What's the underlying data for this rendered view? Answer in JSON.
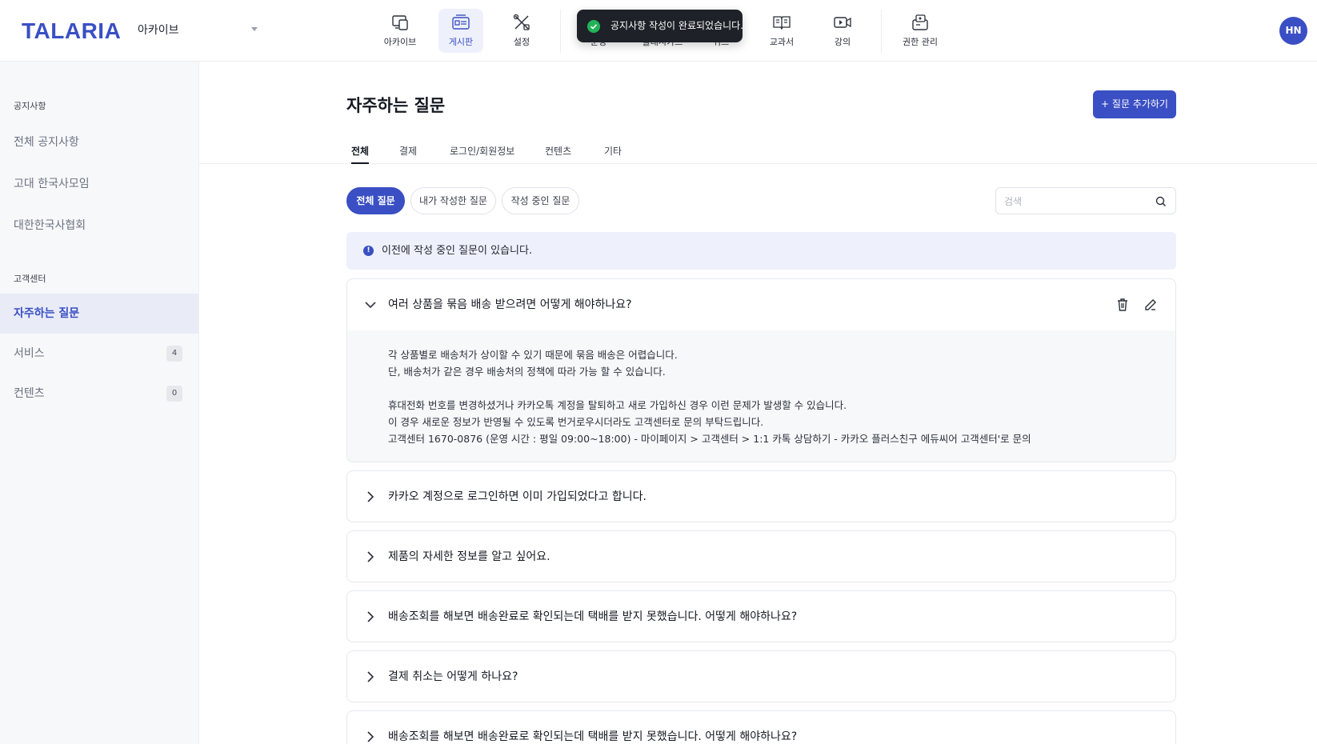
{
  "header": {
    "logo": "TALARIA",
    "archive_select": "아카이브",
    "nav": [
      {
        "label": "아카이브",
        "icon": "archive-icon"
      },
      {
        "label": "게시판",
        "icon": "board-icon"
      },
      {
        "label": "설정",
        "icon": "settings-icon"
      },
      {
        "label": "운영",
        "icon": "operation-icon"
      },
      {
        "label": "플래시카드",
        "icon": "flashcard-icon"
      },
      {
        "label": "퀴즈",
        "icon": "quiz-icon"
      },
      {
        "label": "교과서",
        "icon": "textbook-icon"
      },
      {
        "label": "강의",
        "icon": "lecture-icon"
      },
      {
        "label": "권한 관리",
        "icon": "permission-icon"
      }
    ],
    "avatar": "HN"
  },
  "toast": {
    "message": "공지사항 작성이 완료되었습니다."
  },
  "sidebar": {
    "groups": [
      {
        "title": "공지사항",
        "items": [
          {
            "label": "전체 공지사항"
          },
          {
            "label": "고대 한국사모임"
          },
          {
            "label": "대한한국사협회"
          }
        ]
      },
      {
        "title": "고객센터",
        "items": [
          {
            "label": "자주하는 질문"
          },
          {
            "label": "서비스",
            "count": "4"
          },
          {
            "label": "컨텐츠",
            "count": "0"
          }
        ]
      }
    ]
  },
  "main": {
    "title": "자주하는 질문",
    "add_button": "+ 질문 추가하기",
    "tabs": [
      "전체",
      "결제",
      "로그인/회원정보",
      "컨텐츠",
      "기타"
    ],
    "filters": [
      "전체 질문",
      "내가 작성한 질문",
      "작성 중인 질문"
    ],
    "search_placeholder": "검색",
    "notice": "이전에 작성 중인 질문이 있습니다.",
    "faqs": [
      {
        "question": "여러 상품을 묶음 배송 받으려면 어떻게 해야하나요?",
        "answer": [
          "각 상품별로 배송처가 상이할 수 있기 때문에 묶음 배송은 어렵습니다.",
          "단, 배송처가 같은 경우 배송처의 정책에 따라 가능 할 수 있습니다.",
          "",
          "휴대전화 번호를 변경하셨거나 카카오톡 계정을 탈퇴하고 새로 가입하신 경우 이런 문제가 발생할 수 있습니다.",
          "이 경우 새로운 정보가 반영될 수 있도록 번거로우시더라도 고객센터로 문의 부탁드립니다.",
          "고객센터 1670-0876 (운영 시간 : 평일 09:00~18:00) - 마이페이지  > 고객센터 > 1:1 카톡 상담하기 - 카카오 플러스친구 에듀씨어 고객센터'로 문의"
        ]
      },
      {
        "question": "카카오 계정으로 로그인하면 이미 가입되었다고 합니다."
      },
      {
        "question": "제품의 자세한 정보를 알고 싶어요."
      },
      {
        "question": "배송조회를 해보면 배송완료로 확인되는데 택배를 받지 못했습니다. 어떻게 해야하나요?"
      },
      {
        "question": "결제 취소는 어떻게 하나요?"
      },
      {
        "question": "배송조회를 해보면 배송완료로 확인되는데 택배를 받지 못했습니다. 어떻게 해야하나요?"
      }
    ]
  },
  "colors": {
    "accent": "#3a4fc4",
    "success": "#22b257",
    "toast_bg": "#1e2128"
  }
}
